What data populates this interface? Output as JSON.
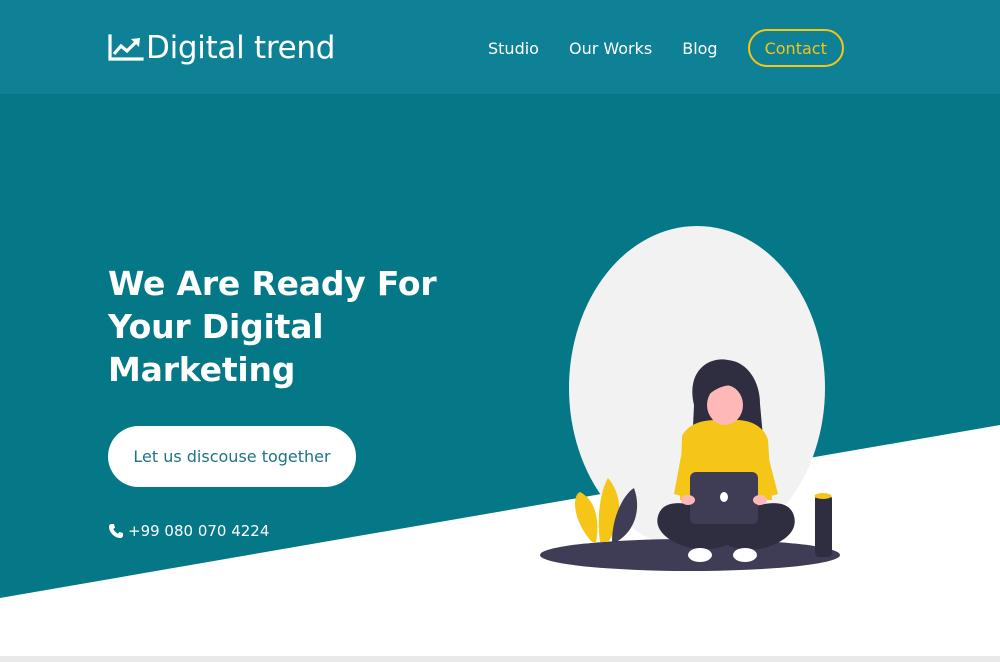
{
  "brand": {
    "name": "Digital trend",
    "icon": "trending-chart-icon"
  },
  "nav": {
    "items": [
      "Studio",
      "Our Works",
      "Blog"
    ],
    "contact_label": "Contact"
  },
  "hero": {
    "headline_line1": "We Are Ready For",
    "headline_line2": "Your Digital",
    "headline_line3": "Marketing",
    "cta_label": "Let us discouse together",
    "phone": "+99 080 070 4224",
    "phone_icon": "phone-icon",
    "illustration": "woman-with-laptop-illustration"
  },
  "colors": {
    "teal": "#057887",
    "header_teal": "#0e8196",
    "accent_yellow": "#f5c518",
    "white": "#ffffff",
    "dark": "#3f3d56"
  }
}
